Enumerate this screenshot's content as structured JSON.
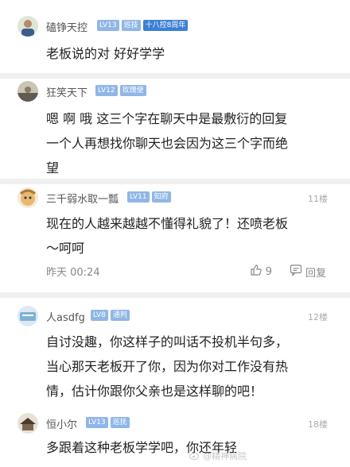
{
  "comments": [
    {
      "username": "磕铮天控",
      "badges": [
        "LV13",
        "巡技",
        "十八控8周年"
      ],
      "floor": "",
      "lines": [
        "老板说的对 好好学学"
      ]
    },
    {
      "username": "狂笑天下",
      "badges": [
        "LV12",
        "玫瑰使"
      ],
      "floor": "",
      "lines": [
        "嗯 啊 哦 这三个字在聊天中是最敷衍的回复",
        "一个人再想找你聊天也会因为这三个字而绝",
        "望"
      ]
    },
    {
      "username": "三千弱水取一瓢",
      "badges": [
        "LV11",
        "知府"
      ],
      "floor": "11楼",
      "lines": [
        "现在的人越来越越不懂得礼貌了！还喷老板",
        "～呵呵"
      ],
      "time": "昨天 00:24",
      "likes": "9",
      "reply_label": "回复"
    },
    {
      "username": "人asdfg",
      "badges": [
        "LV8",
        "通判"
      ],
      "floor": "12楼",
      "lines": [
        "自讨没趣，你这样子的叫话不投机半句多，",
        "当心那天老板开了你，因为你对工作没有热",
        "情，估计你跟你父亲也是这样聊的吧！"
      ]
    },
    {
      "username": "恒小尔",
      "badges": [
        "LV13",
        "巡抚"
      ],
      "floor": "18楼",
      "lines": [
        "多跟着这种老板学学吧，你还年轻"
      ]
    }
  ],
  "watermark": "@精神病院",
  "colors": {
    "badge": "#8fb6e6",
    "badge_dark": "#3d7fd6",
    "divider": "#f0f0f0",
    "text": "#222222",
    "meta": "#888888"
  }
}
